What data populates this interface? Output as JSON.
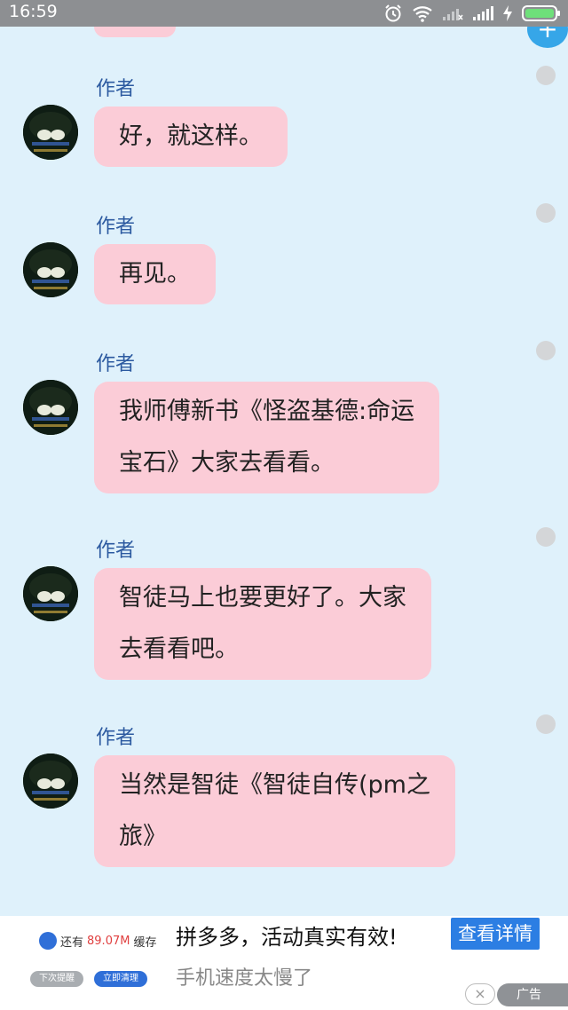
{
  "status_bar": {
    "time": "16:59",
    "icons": [
      "alarm-icon",
      "wifi-icon",
      "cellular-signal-weak-icon",
      "cellular-signal-full-icon",
      "charging-icon",
      "battery-icon"
    ]
  },
  "chat": {
    "messages": [
      {
        "author": "作者",
        "lines": [
          "好，就这样。"
        ]
      },
      {
        "author": "作者",
        "lines": [
          "再见。"
        ]
      },
      {
        "author": "作者",
        "lines": [
          "我师傅新书《怪盗基德:命运",
          "宝石》大家去看看。"
        ]
      },
      {
        "author": "作者",
        "lines": [
          "智徒马上也要更好了。大家",
          "去看看吧。"
        ]
      },
      {
        "author": "作者",
        "lines": [
          "当然是智徒《智徒自传(pm之",
          "旅》"
        ]
      }
    ],
    "fab_label": "+"
  },
  "ad": {
    "cache_prefix": "还有",
    "cache_size": "89.07M",
    "cache_suffix": "缓存",
    "later_label": "下次提醒",
    "clean_label": "立即清理",
    "headline": "拼多多，活动真实有效!",
    "subtitle": "手机速度太慢了",
    "cta_label": "查看详情",
    "close_label": "×",
    "ad_tag": "广告",
    "accent_color": "#2c7ee3"
  },
  "colors": {
    "background": "#dff1fb",
    "bubble": "#fbccd7",
    "author_name": "#2c5aa0",
    "status_bar": "#8d8f92"
  }
}
